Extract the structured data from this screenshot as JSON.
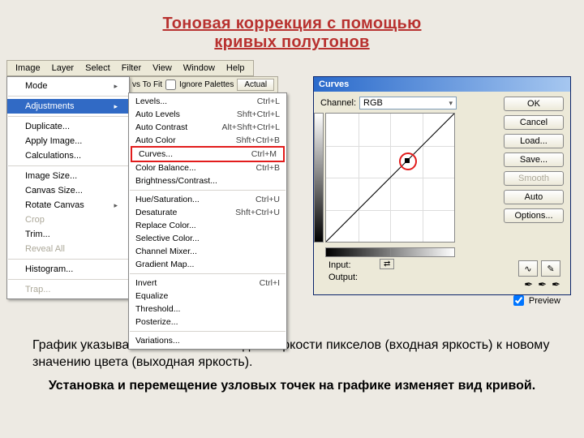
{
  "title_line1": "Тоновая коррекция с помощью",
  "title_line2": "кривых полутонов",
  "menubar": [
    "Image",
    "Layer",
    "Select",
    "Filter",
    "View",
    "Window",
    "Help"
  ],
  "toolbar": {
    "fit": "vs To Fit",
    "ignore": "Ignore Palettes",
    "actual": "Actual"
  },
  "image_menu": {
    "mode": "Mode",
    "adjustments": "Adjustments",
    "duplicate": "Duplicate...",
    "apply": "Apply Image...",
    "calc": "Calculations...",
    "imgsize": "Image Size...",
    "cansize": "Canvas Size...",
    "rotate": "Rotate Canvas",
    "crop": "Crop",
    "trim": "Trim...",
    "reveal": "Reveal All",
    "hist": "Histogram...",
    "trap": "Trap..."
  },
  "adjust_menu": [
    {
      "l": "Levels...",
      "s": "Ctrl+L"
    },
    {
      "l": "Auto Levels",
      "s": "Shft+Ctrl+L"
    },
    {
      "l": "Auto Contrast",
      "s": "Alt+Shft+Ctrl+L"
    },
    {
      "l": "Auto Color",
      "s": "Shft+Ctrl+B"
    },
    {
      "l": "Curves...",
      "s": "Ctrl+M",
      "hl": true
    },
    {
      "l": "Color Balance...",
      "s": "Ctrl+B"
    },
    {
      "l": "Brightness/Contrast...",
      "s": ""
    },
    {
      "sep": true
    },
    {
      "l": "Hue/Saturation...",
      "s": "Ctrl+U"
    },
    {
      "l": "Desaturate",
      "s": "Shft+Ctrl+U"
    },
    {
      "l": "Replace Color...",
      "s": ""
    },
    {
      "l": "Selective Color...",
      "s": ""
    },
    {
      "l": "Channel Mixer...",
      "s": ""
    },
    {
      "l": "Gradient Map...",
      "s": ""
    },
    {
      "sep": true
    },
    {
      "l": "Invert",
      "s": "Ctrl+I"
    },
    {
      "l": "Equalize",
      "s": ""
    },
    {
      "l": "Threshold...",
      "s": ""
    },
    {
      "l": "Posterize...",
      "s": ""
    },
    {
      "sep": true
    },
    {
      "l": "Variations...",
      "s": ""
    }
  ],
  "curves": {
    "title": "Curves",
    "channel_label": "Channel:",
    "channel_value": "RGB",
    "input_label": "Input:",
    "output_label": "Output:",
    "buttons": {
      "ok": "OK",
      "cancel": "Cancel",
      "load": "Load...",
      "save": "Save...",
      "smooth": "Smooth",
      "auto": "Auto",
      "options": "Options..."
    },
    "preview": "Preview",
    "curve_icon": "∿",
    "pencil_icon": "✎",
    "arrows": "⇄"
  },
  "chart_data": {
    "type": "line",
    "title": "Curves",
    "xlabel": "Input",
    "ylabel": "Output",
    "xlim": [
      0,
      255
    ],
    "ylim": [
      0,
      255
    ],
    "series": [
      {
        "name": "RGB",
        "x": [
          0,
          255
        ],
        "y": [
          0,
          255
        ]
      }
    ],
    "points": [
      {
        "x": 160,
        "y": 160
      }
    ],
    "grid": true
  },
  "para1": "График указывает отношение исходной яркости пикселов (входная яркость) к новому значению цвета (выходная яркость).",
  "para2": "Установка и перемещение узловых точек на графике изменяет вид кривой."
}
